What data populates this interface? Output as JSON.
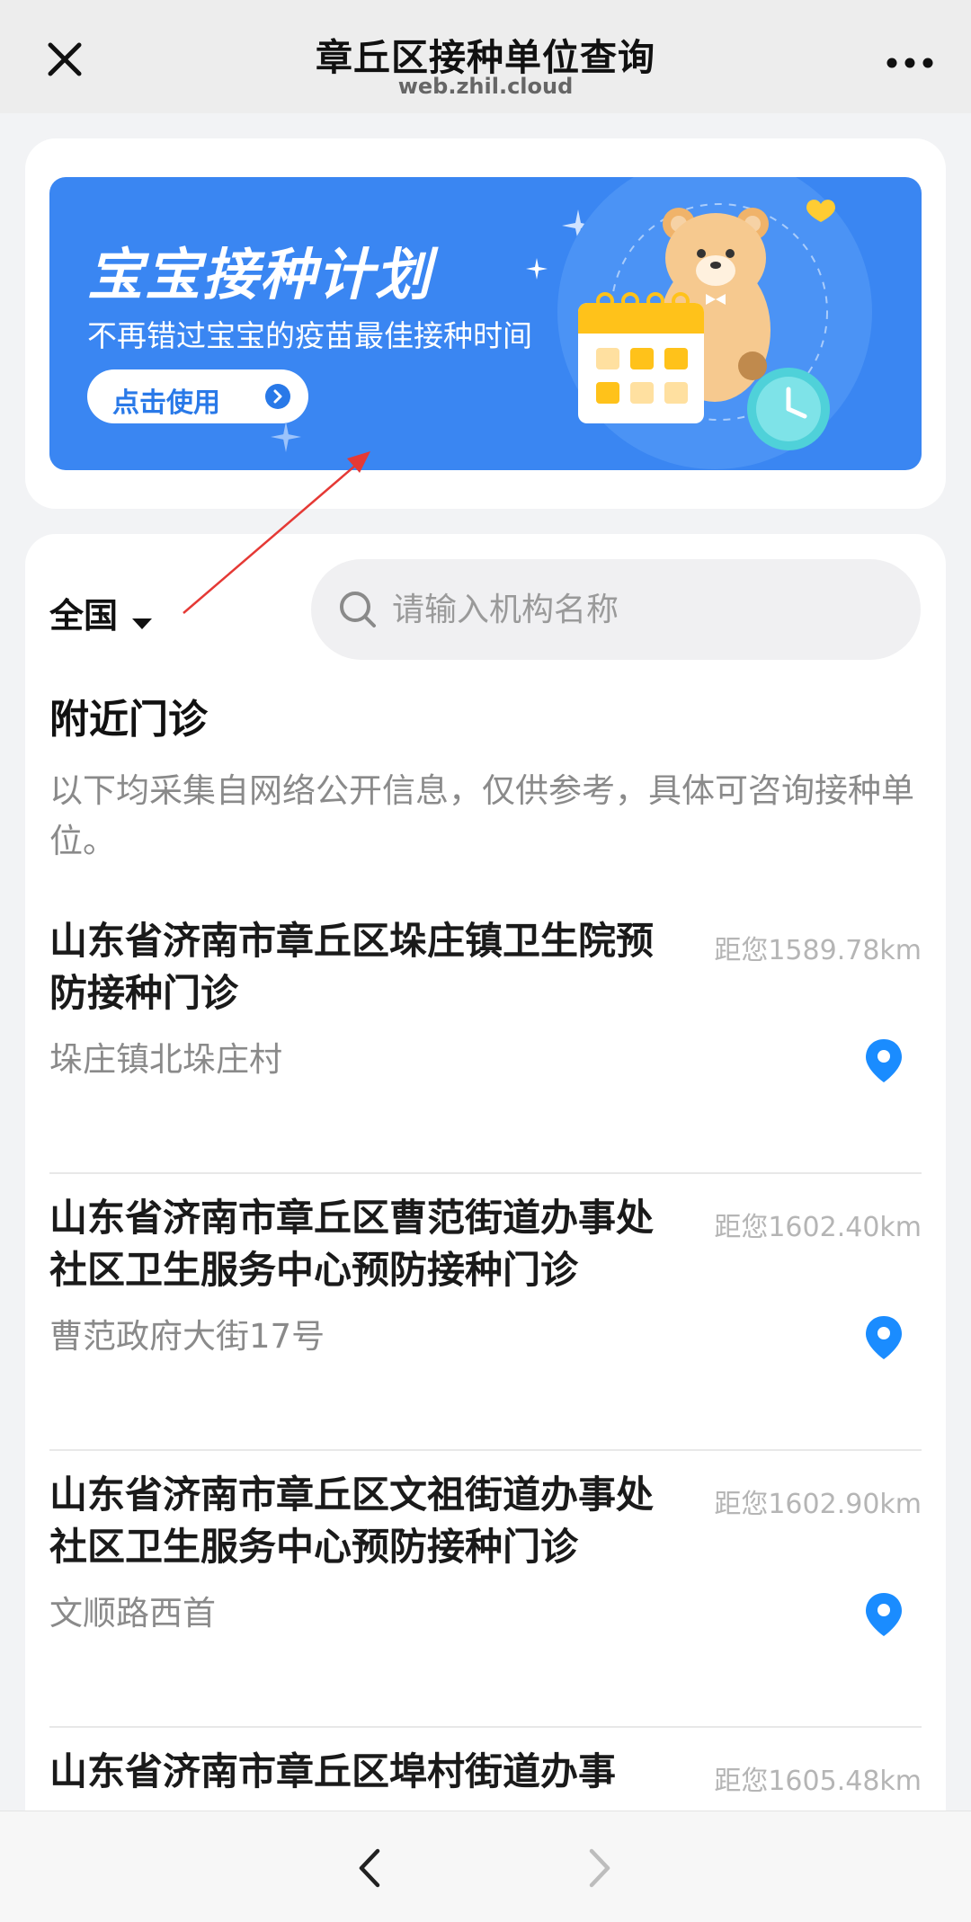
{
  "header": {
    "title": "章丘区接种单位查询",
    "subtitle": "web.zhil.cloud",
    "close_icon": "close-icon",
    "more_icon": "more-icon"
  },
  "banner": {
    "title": "宝宝接种计划",
    "subtitle": "不再错过宝宝的疫苗最佳接种时间",
    "button_label": "点击使用",
    "background_color": "#3a86f2"
  },
  "filter": {
    "region": "全国",
    "search_placeholder": "请输入机构名称"
  },
  "nearby": {
    "title": "附近门诊",
    "note": "以下均采集自网络公开信息，仅供参考，具体可咨询接种单位。"
  },
  "clinics": [
    {
      "name": "山东省济南市章丘区垛庄镇卫生院预防接种门诊",
      "distance": "距您1589.78km",
      "address": "垛庄镇北垛庄村"
    },
    {
      "name": "山东省济南市章丘区曹范街道办事处社区卫生服务中心预防接种门诊",
      "distance": "距您1602.40km",
      "address": "曹范政府大街17号"
    },
    {
      "name": "山东省济南市章丘区文祖街道办事处社区卫生服务中心预防接种门诊",
      "distance": "距您1602.90km",
      "address": "文顺路西首"
    },
    {
      "name": "山东省济南市章丘区埠村街道办事",
      "distance": "距您1605.48km",
      "address": ""
    }
  ],
  "colors": {
    "accent": "#2979e8",
    "pin": "#1a8cff",
    "annotation": "#e53935"
  }
}
